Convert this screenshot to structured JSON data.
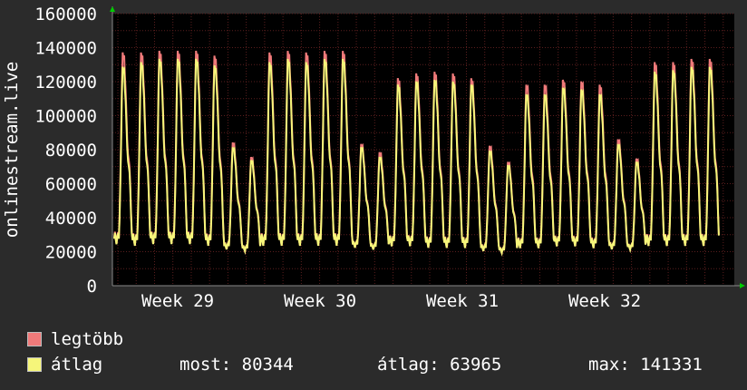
{
  "chart_data": {
    "type": "line",
    "ylabel": "onlinestream.live",
    "ylim": [
      0,
      160000
    ],
    "y_ticks": [
      "160000",
      "140000",
      "120000",
      "100000",
      "80000",
      "60000",
      "40000",
      "20000",
      "0"
    ],
    "x_ticks": [
      "Week 29",
      "Week 30",
      "Week 31",
      "Week 32"
    ],
    "grid": true,
    "colors": {
      "background": "#2b2b2b",
      "plot_background": "#000000",
      "grid": "#5a1e1e",
      "legtobb": "#f07a7a",
      "atlag": "#f6f67a",
      "arrow": "#00cc00"
    },
    "daily_peaks_max": [
      144000,
      144000,
      145000,
      145000,
      145000,
      142000,
      88000,
      79000,
      144000,
      145000,
      144000,
      145000,
      145000,
      87000,
      82000,
      128000,
      131000,
      132000,
      131000,
      128000,
      86000,
      76000,
      124000,
      124000,
      127000,
      126000,
      124000,
      90000,
      78000,
      138000,
      138000,
      140000,
      140000
    ],
    "daily_peaks_avg": [
      135000,
      138000,
      140000,
      140000,
      140000,
      136000,
      85000,
      77000,
      138000,
      140000,
      138000,
      140000,
      140000,
      85000,
      79000,
      124000,
      126000,
      127000,
      126000,
      124000,
      83000,
      74000,
      118000,
      118000,
      122000,
      121000,
      118000,
      87000,
      76000,
      132000,
      133000,
      135000,
      135000
    ],
    "daily_mins": [
      22000,
      21000,
      22000,
      22000,
      22000,
      21000,
      20000,
      19000,
      21000,
      21000,
      21000,
      21000,
      21000,
      21000,
      20000,
      21000,
      21000,
      20000,
      20000,
      20000,
      19000,
      18000,
      20000,
      20000,
      21000,
      21000,
      20000,
      20000,
      20000,
      21000,
      21000,
      21000,
      21000
    ],
    "series": [
      {
        "name": "legtöbb",
        "color": "#f07a7a"
      },
      {
        "name": "átlag",
        "color": "#f6f67a"
      }
    ]
  },
  "legend": {
    "max_label": "legtöbb",
    "avg_label": "átlag"
  },
  "stats": {
    "now": "most: 80344",
    "avg": "átlag: 63965",
    "max": "max: 141331"
  }
}
